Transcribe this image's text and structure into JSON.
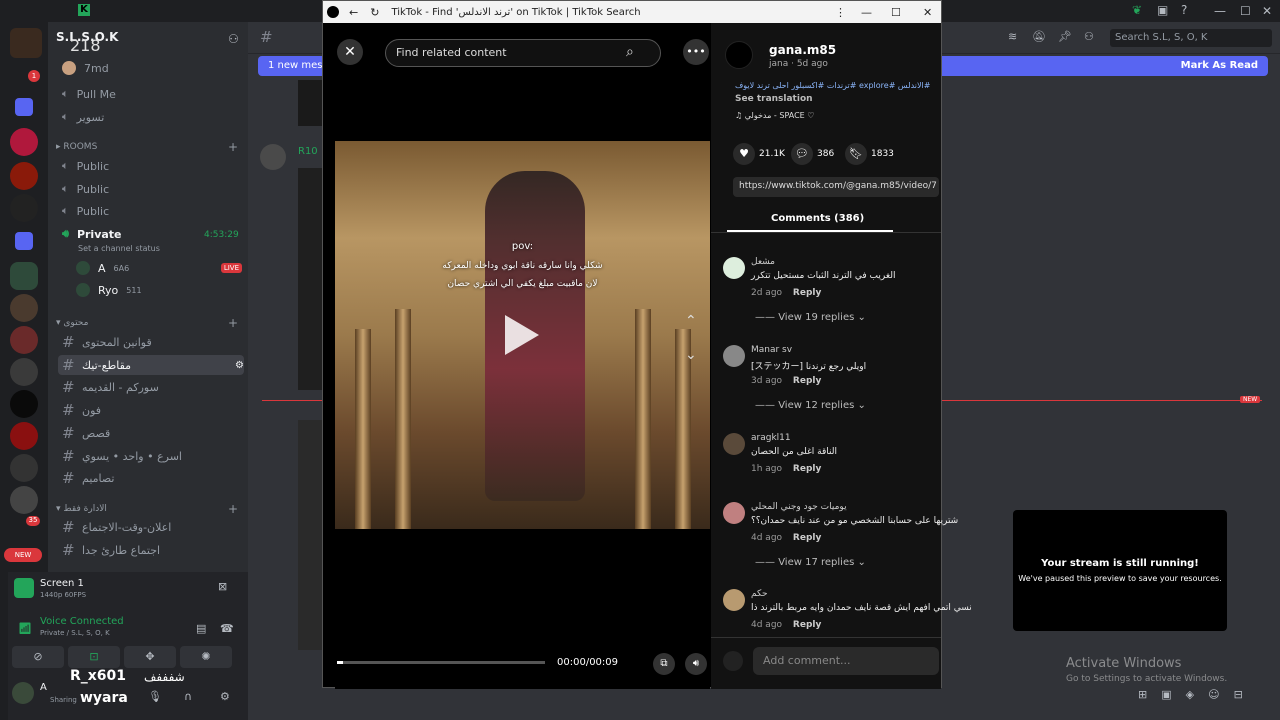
{
  "discord": {
    "server_name": "S.L.S.O.K",
    "top_number": "218",
    "pinned_users": [
      "7md"
    ],
    "voice_items": [
      "Pull Me",
      "تسوير"
    ],
    "rooms_category": "ROOMS",
    "public_channels": [
      "Public",
      "Public",
      "Public"
    ],
    "private_channel": "Private",
    "private_time": "4:53:29",
    "channel_status": "Set a channel status",
    "voice_users": [
      {
        "name": "A",
        "tag": "6A6",
        "badge": "LIVE"
      },
      {
        "name": "Ryo",
        "tag": "511",
        "badge": ""
      }
    ],
    "content_category": "محتوى",
    "text_channels": [
      "قوانين المحتوى",
      "مقاطع-تيك",
      "سوركم - القديمه",
      "فون",
      "قصص",
      "اسرع • واحد • يسوي",
      "تصاميم"
    ],
    "admin_category": "الادارة فقط",
    "admin_channels": [
      "اعلان-وقت-الاجتماع",
      "اجتماع طارئ جدا"
    ],
    "new_badge": "NEW",
    "new_messages": "1 new messages",
    "mark_as_read": "Mark As Read",
    "search_placeholder": "Search S.L, S, O, K",
    "screen_title": "Screen 1",
    "screen_quality": "1440p 60FPS",
    "voice_connected": "Voice Connected",
    "voice_channel": "Private / S.L, S, O, K",
    "user_name": "A",
    "user_status": "Sharing",
    "overlay_name_1": "R_x601",
    "overlay_name_2": "wyara",
    "overlay_arabic": "شفففف",
    "message_user": "R10"
  },
  "tiktok": {
    "window_title": "TikTok - Find 'ترند الاندلس' on TikTok | TikTok Search",
    "search_placeholder": "Find related content",
    "pov_text": "pov:",
    "caption_line1": "شكلي وانا سارقه ناقة ابوي وداخله المعركه",
    "caption_line2": "لان ماقبيت مبلغ يكفي الي اشتري حصان",
    "time": "00:00/00:09",
    "progress": 0.0,
    "author": "gana.m85",
    "author_meta": "jana · 5d ago",
    "description": "#الاندلس #explore #ترندات #اكسبلور احلى ترند لايوف",
    "see_translation": "See translation",
    "music": "♫ مدخولي - SPACE ♡",
    "likes": "21.1K",
    "comments_count": "386",
    "saves": "1833",
    "url": "https://www.tiktok.com/@gana.m85/video/7",
    "comments_tab": "Comments (386)",
    "add_comment": "Add comment...",
    "comments": [
      {
        "user": "مشعل",
        "text": "الغريب في الترند الثبات مستحيل تتكرر",
        "date": "2d ago",
        "reply": "Reply",
        "replies": "View 19 replies"
      },
      {
        "user": "Manar sv",
        "text": "اويلي رجع ترندنا [ステッカー]",
        "date": "3d ago",
        "reply": "Reply",
        "replies": "View 12 replies"
      },
      {
        "user": "aragkl11",
        "text": "الناقة اغلى من الحصان",
        "date": "1h ago",
        "reply": "Reply",
        "replies": ""
      },
      {
        "user": "يوميات جود وجني المحلي",
        "text": "شتريها على حسابنا الشخصي مو من عند نايف حمدان؟؟",
        "date": "4d ago",
        "reply": "Reply",
        "replies": "View 17 replies"
      },
      {
        "user": "حكم",
        "text": "نسي اتمي افهم ايش قصة نايف حمدان وايه مربط بالترند ذا",
        "date": "4d ago",
        "reply": "Reply",
        "replies": ""
      }
    ]
  },
  "toast": {
    "title": "Your stream is still running!",
    "body": "We've paused this preview to save your resources."
  },
  "windows": {
    "activate_title": "Activate Windows",
    "activate_body": "Go to Settings to activate Windows."
  },
  "colors": {
    "discord_bg": "#313338",
    "sidebar": "#2b2d31",
    "blurple": "#5865f2",
    "live_red": "#da373c",
    "green": "#23a55a"
  }
}
